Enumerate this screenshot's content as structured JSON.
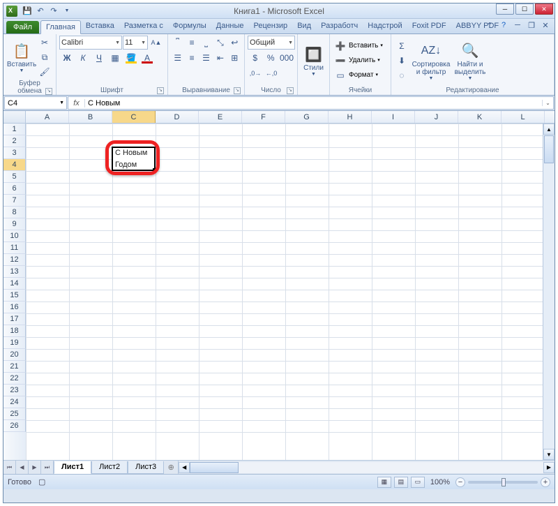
{
  "title": "Книга1  -  Microsoft Excel",
  "tabs": {
    "file": "Файл",
    "list": [
      "Главная",
      "Вставка",
      "Разметка с",
      "Формулы",
      "Данные",
      "Рецензир",
      "Вид",
      "Разработч",
      "Надстрой",
      "Foxit PDF",
      "ABBYY PDF"
    ],
    "active_index": 0
  },
  "ribbon": {
    "clipboard": {
      "paste": "Вставить",
      "label": "Буфер обмена"
    },
    "font": {
      "name": "Calibri",
      "size": "11",
      "label": "Шрифт",
      "bold": "Ж",
      "italic": "К",
      "underline": "Ч"
    },
    "alignment": {
      "label": "Выравнивание"
    },
    "number": {
      "format": "Общий",
      "label": "Число"
    },
    "styles": {
      "label": "Стили",
      "btn": "Стили"
    },
    "cells": {
      "insert": "Вставить",
      "delete": "Удалить",
      "format": "Формат",
      "label": "Ячейки"
    },
    "editing": {
      "sort": "Сортировка\nи фильтр",
      "find": "Найти и\nвыделить",
      "label": "Редактирование"
    }
  },
  "formula_bar": {
    "namebox": "C4",
    "fx": "fx",
    "formula": "С Новым"
  },
  "grid": {
    "columns": [
      "A",
      "B",
      "C",
      "D",
      "E",
      "F",
      "G",
      "H",
      "I",
      "J",
      "K",
      "L"
    ],
    "rows": 26,
    "selected_col_index": 2,
    "selected_row_index": 3,
    "selection": {
      "col": 2,
      "row": 2,
      "w": 1,
      "h": 2
    },
    "cells": [
      {
        "col": 2,
        "row": 2,
        "text": "С Новым"
      },
      {
        "col": 2,
        "row": 3,
        "text": "Годом"
      }
    ]
  },
  "sheet_tabs": {
    "list": [
      "Лист1",
      "Лист2",
      "Лист3"
    ],
    "active_index": 0
  },
  "status": {
    "ready": "Готово",
    "zoom": "100%"
  }
}
